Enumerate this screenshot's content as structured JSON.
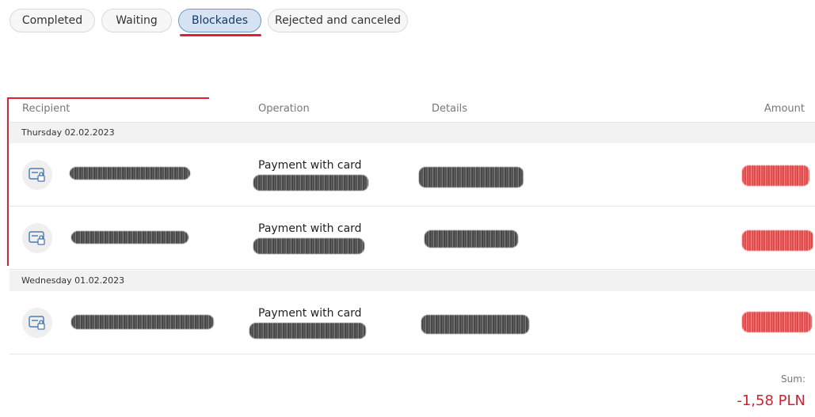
{
  "tabs": [
    {
      "label": "Completed",
      "active": false
    },
    {
      "label": "Waiting",
      "active": false
    },
    {
      "label": "Blockades",
      "active": true
    },
    {
      "label": "Rejected and canceled",
      "active": false
    }
  ],
  "table": {
    "headers": {
      "recipient": "Recipient",
      "operation": "Operation",
      "details": "Details",
      "amount": "Amount"
    }
  },
  "groups": [
    {
      "date": "Thursday 02.02.2023",
      "rows": [
        {
          "icon": "card-lock-icon",
          "operation": "Payment with card"
        },
        {
          "icon": "card-lock-icon",
          "operation": "Payment with card"
        }
      ]
    },
    {
      "date": "Wednesday 01.02.2023",
      "rows": [
        {
          "icon": "card-lock-icon",
          "operation": "Payment with card"
        }
      ]
    }
  ],
  "summary": {
    "label": "Sum:",
    "value": "-1,58 PLN"
  },
  "colors": {
    "accent_red": "#e3202f",
    "active_tab_bg": "#d6e3f3",
    "amount_red": "#d61f2c"
  }
}
